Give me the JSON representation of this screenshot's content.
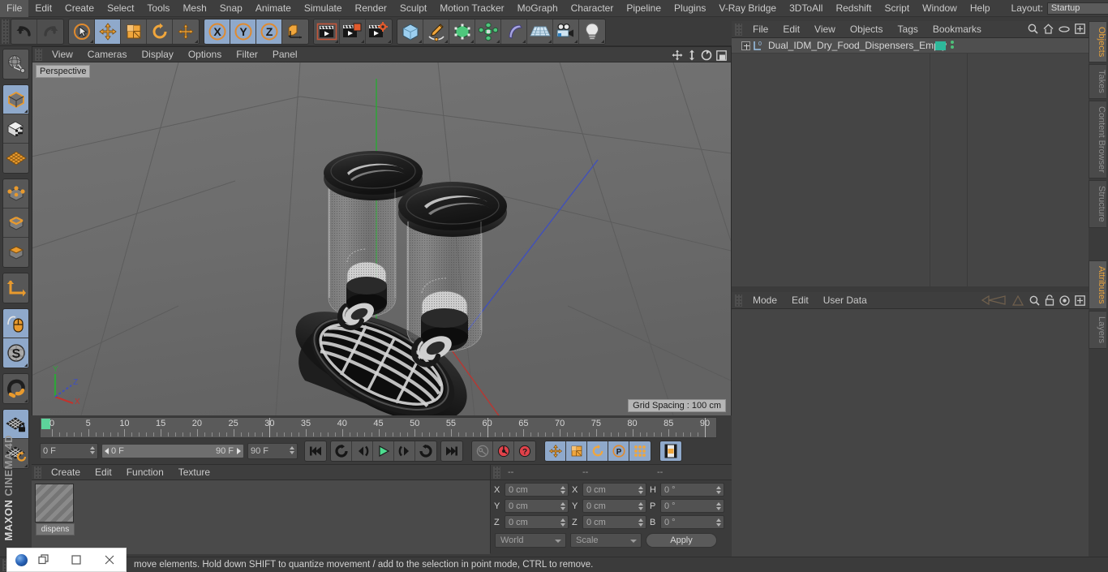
{
  "menubar": {
    "items": [
      "File",
      "Edit",
      "Create",
      "Select",
      "Tools",
      "Mesh",
      "Snap",
      "Animate",
      "Simulate",
      "Render",
      "Sculpt",
      "Motion Tracker",
      "MoGraph",
      "Character",
      "Pipeline",
      "Plugins",
      "V-Ray Bridge",
      "3DToAll",
      "Redshift",
      "Script",
      "Window",
      "Help"
    ],
    "layout_label": "Layout:",
    "layout_value": "Startup"
  },
  "toolbar": {
    "groups": [
      {
        "name": "undo-redo",
        "buttons": [
          {
            "name": "undo-button",
            "icon": "undo-icon"
          },
          {
            "name": "redo-button",
            "icon": "redo-icon"
          }
        ]
      },
      {
        "name": "transform-tools",
        "buttons": [
          {
            "name": "live-selection-button",
            "icon": "live-selection-icon"
          },
          {
            "name": "move-tool-button",
            "icon": "move-icon"
          },
          {
            "name": "scale-tool-button",
            "icon": "scale-icon"
          },
          {
            "name": "rotate-tool-button",
            "icon": "rotate-icon"
          },
          {
            "name": "default-axis-button",
            "icon": "axis-move-icon"
          }
        ]
      },
      {
        "name": "axis-locks",
        "buttons": [
          {
            "name": "lock-x-button",
            "icon": "x-axis-icon"
          },
          {
            "name": "lock-y-button",
            "icon": "y-axis-icon"
          },
          {
            "name": "lock-z-button",
            "icon": "z-axis-icon"
          },
          {
            "name": "world-object-coords-button",
            "icon": "world-axis-icon"
          }
        ]
      },
      {
        "name": "render-tools",
        "buttons": [
          {
            "name": "render-view-button",
            "icon": "render-view-icon"
          },
          {
            "name": "render-region-button",
            "icon": "render-region-icon"
          },
          {
            "name": "render-settings-button",
            "icon": "render-settings-icon"
          }
        ]
      },
      {
        "name": "object-creation",
        "buttons": [
          {
            "name": "add-cube-button",
            "icon": "cube-icon"
          },
          {
            "name": "add-spline-button",
            "icon": "pen-spline-icon"
          },
          {
            "name": "nurbs-button",
            "icon": "green-cube-icon"
          },
          {
            "name": "array-button",
            "icon": "array-icon"
          },
          {
            "name": "bend-deformer-button",
            "icon": "bend-deformer-icon"
          },
          {
            "name": "floor-environment-button",
            "icon": "floor-icon"
          },
          {
            "name": "camera-button",
            "icon": "camera-icon"
          },
          {
            "name": "light-button",
            "icon": "light-bulb-icon"
          }
        ]
      }
    ]
  },
  "left_toolbar": {
    "buttons": [
      {
        "name": "make-editable-button",
        "icon": "globe-editable-icon",
        "active": false
      },
      {
        "name": "model-mode-button",
        "icon": "model-cube-icon",
        "active": true
      },
      {
        "name": "texture-mode-button",
        "icon": "texture-cube-icon",
        "active": false
      },
      {
        "name": "workplane-button",
        "icon": "workplane-grid-icon",
        "active": false
      },
      {
        "name": "points-mode-button",
        "icon": "points-cube-icon",
        "active": false
      },
      {
        "name": "edges-mode-button",
        "icon": "edges-cube-icon",
        "active": false
      },
      {
        "name": "polygons-mode-button",
        "icon": "polygons-cube-icon",
        "active": false
      },
      {
        "name": "axis-modify-button",
        "icon": "axis-l-icon",
        "active": false
      },
      {
        "name": "enable-snap-button",
        "icon": "mouse-icon",
        "active": true
      },
      {
        "name": "soft-selection-button",
        "icon": "s-circle-icon",
        "active": true
      },
      {
        "name": "magnet-button",
        "icon": "magnet-icon",
        "active": false
      },
      {
        "name": "lock-workplane-button",
        "icon": "grid-lock-icon",
        "active": true
      },
      {
        "name": "planar-workplane-button",
        "icon": "grid-rotate-icon",
        "active": false
      }
    ],
    "brand_top": "MAXON",
    "brand_bottom": "CINEMA 4D"
  },
  "viewport": {
    "menu_items": [
      "View",
      "Cameras",
      "Display",
      "Options",
      "Filter",
      "Panel"
    ],
    "label": "Perspective",
    "grid_spacing": "Grid Spacing : 100 cm",
    "axis_labels": {
      "x": "X",
      "y": "Y",
      "z": "Z"
    },
    "nav_icons": [
      "pan-icon",
      "dolly-icon",
      "rotate-view-icon",
      "maximize-view-icon"
    ]
  },
  "timeline": {
    "tick_labels": [
      "0",
      "5",
      "10",
      "15",
      "20",
      "25",
      "30",
      "35",
      "40",
      "45",
      "50",
      "55",
      "60",
      "65",
      "70",
      "75",
      "80",
      "85",
      "90"
    ],
    "current_frame": "0 F",
    "range_start": "0 F",
    "range_end": "90 F",
    "max_frame": "90 F",
    "end_frame_field": "0 F",
    "transport": [
      {
        "name": "go-to-start-button",
        "icon": "skip-start-icon"
      },
      {
        "name": "play-backwards-frame-button",
        "icon": "step-back-icon"
      },
      {
        "name": "go-to-previous-frame-button",
        "icon": "prev-frame-icon"
      },
      {
        "name": "play-button",
        "icon": "play-icon"
      },
      {
        "name": "go-to-next-frame-button",
        "icon": "next-frame-icon"
      },
      {
        "name": "play-forwards-button",
        "icon": "loop-icon"
      },
      {
        "name": "go-to-end-button",
        "icon": "skip-end-icon"
      }
    ],
    "record_group": [
      {
        "name": "autokeying-button",
        "icon": "key-icon"
      },
      {
        "name": "record-active-objects-button",
        "icon": "record-icon"
      },
      {
        "name": "keyframe-selection-button",
        "icon": "keyframe-selection-icon"
      }
    ],
    "pos_group": [
      {
        "name": "record-position-button",
        "icon": "move-icon"
      },
      {
        "name": "record-scale-button",
        "icon": "scale-icon"
      },
      {
        "name": "record-rotation-button",
        "icon": "rotate-icon"
      },
      {
        "name": "record-param-button",
        "icon": "p-circle-icon"
      },
      {
        "name": "record-pla-button",
        "icon": "dots-grid-icon"
      }
    ],
    "timeline_toggle": {
      "name": "timeline-toggle-button",
      "icon": "film-strip-icon"
    }
  },
  "material_manager": {
    "menu_items": [
      "Create",
      "Edit",
      "Function",
      "Texture"
    ],
    "materials": [
      {
        "name": "dispens"
      }
    ]
  },
  "coordinates": {
    "header_cols": [
      "--",
      "--",
      "--"
    ],
    "rows": [
      {
        "pos_label": "X",
        "pos_value": "0 cm",
        "size_label": "X",
        "size_value": "0 cm",
        "rot_label": "H",
        "rot_value": "0 °"
      },
      {
        "pos_label": "Y",
        "pos_value": "0 cm",
        "size_label": "Y",
        "size_value": "0 cm",
        "rot_label": "P",
        "rot_value": "0 °"
      },
      {
        "pos_label": "Z",
        "pos_value": "0 cm",
        "size_label": "Z",
        "size_value": "0 cm",
        "rot_label": "B",
        "rot_value": "0 °"
      }
    ],
    "coord_system": "World",
    "transform_mode": "Scale",
    "apply_label": "Apply"
  },
  "object_manager": {
    "menu_items": [
      "File",
      "Edit",
      "View",
      "Objects",
      "Tags",
      "Bookmarks"
    ],
    "objects": [
      {
        "name": "Dual_IDM_Dry_Food_Dispensers_Empty",
        "tag_color": "#2eb79a"
      }
    ],
    "icons": [
      "search-icon",
      "home-icon",
      "ellipse-icon",
      "plus-box-icon"
    ]
  },
  "attribute_manager": {
    "menu_items": [
      "Mode",
      "Edit",
      "User Data"
    ],
    "icons": [
      "back-nav-icon",
      "up-nav-icon",
      "search-icon",
      "lock-icon",
      "target-icon",
      "plus-box-icon"
    ]
  },
  "tabstrip": {
    "right_tabs": [
      {
        "label": "Objects",
        "selected": true
      },
      {
        "label": "Takes",
        "selected": false
      },
      {
        "label": "Content Browser",
        "selected": false
      },
      {
        "label": "Structure",
        "selected": false
      }
    ],
    "lower_tabs": [
      {
        "label": "Attributes",
        "selected": true
      },
      {
        "label": "Layers",
        "selected": false
      }
    ]
  },
  "statusbar": {
    "message": "move elements. Hold down SHIFT to quantize movement / add to the selection in point mode, CTRL to remove."
  },
  "overlay_window": {
    "buttons": [
      "restore-icon",
      "maximize-icon",
      "close-icon"
    ]
  },
  "colors": {
    "accent_blue": "#8fa9cb",
    "accent_orange": "#e8a33d",
    "teal_tag": "#2eb79a",
    "panel_bg": "#3b3b3b",
    "viewport_bg": "#6d6d6d"
  }
}
